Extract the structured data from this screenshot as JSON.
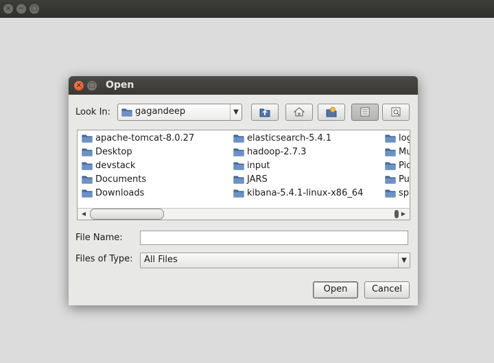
{
  "outer_window": {
    "buttons": [
      "×",
      "−",
      "□"
    ]
  },
  "dialog": {
    "title": "Open",
    "titlebar_buttons": {
      "close": "×",
      "minimize": "□"
    },
    "look_in": {
      "label": "Look In:",
      "value": "gagandeep"
    },
    "toolbar": {
      "up_icon": "folder-up-icon",
      "home_icon": "home-icon",
      "new_folder_icon": "new-folder-icon",
      "list_view_icon": "list-view-icon",
      "details_view_icon": "details-view-icon",
      "active_view": "list"
    },
    "files": {
      "columns": [
        [
          "apache-tomcat-8.0.27",
          "Desktop",
          "devstack",
          "Documents",
          "Downloads"
        ],
        [
          "elasticsearch-5.4.1",
          "hadoop-2.7.3",
          "input",
          "JARS",
          "kibana-5.4.1-linux-x86_64"
        ],
        [
          "logs",
          "Music",
          "Pictures",
          "Public",
          "spark"
        ]
      ],
      "visible_third_column": [
        "log",
        "Mu",
        "Pic",
        "Pu",
        "sp"
      ]
    },
    "file_name": {
      "label": "File Name:",
      "value": "",
      "placeholder": ""
    },
    "files_of_type": {
      "label": "Files of Type:",
      "value": "All Files"
    },
    "buttons": {
      "open": "Open",
      "cancel": "Cancel"
    }
  },
  "colors": {
    "titlebar": "#3a3935",
    "dialog_bg": "#e8e8e7",
    "close_button": "#e05a2b"
  }
}
